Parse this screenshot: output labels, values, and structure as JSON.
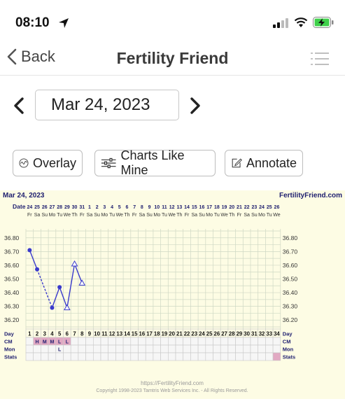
{
  "status_bar": {
    "time": "08:10"
  },
  "nav": {
    "back_label": "Back",
    "title": "Fertility Friend"
  },
  "date_selector": {
    "date": "Mar 24, 2023"
  },
  "buttons": {
    "overlay": "Overlay",
    "charts_like_mine": "Charts Like Mine",
    "annotate": "Annotate"
  },
  "chart": {
    "date_label": "Mar 24, 2023",
    "brand": "FertilityFriend.com",
    "date_row_label": "Date",
    "dates": [
      "24",
      "25",
      "26",
      "27",
      "28",
      "29",
      "30",
      "31",
      "1",
      "2",
      "3",
      "4",
      "5",
      "6",
      "7",
      "8",
      "9",
      "10",
      "11",
      "12",
      "13",
      "14",
      "15",
      "16",
      "17",
      "18",
      "19",
      "20",
      "21",
      "22",
      "23",
      "24",
      "25",
      "26"
    ],
    "weekdays": [
      "Fr",
      "Sa",
      "Su",
      "Mo",
      "Tu",
      "We",
      "Th",
      "Fr",
      "Sa",
      "Su",
      "Mo",
      "Tu",
      "We",
      "Th",
      "Fr",
      "Sa",
      "Su",
      "Mo",
      "Tu",
      "We",
      "Th",
      "Fr",
      "Sa",
      "Su",
      "Mo",
      "Tu",
      "We",
      "Th",
      "Fr",
      "Sa",
      "Su",
      "Mo",
      "Tu",
      "We"
    ],
    "y_ticks": [
      "36.80",
      "36.70",
      "36.60",
      "36.50",
      "36.40",
      "36.30",
      "36.20"
    ],
    "y_min": 36.15,
    "y_max": 36.85,
    "temps": [
      36.71,
      36.57,
      null,
      36.29,
      36.44,
      36.29,
      36.61,
      36.47
    ],
    "open_points": [
      5,
      6,
      7
    ],
    "dashed_segment": [
      1,
      3
    ],
    "row_labels": {
      "day": "Day",
      "cm": "CM",
      "mon": "Mon",
      "stats": "Stats"
    },
    "days": [
      "1",
      "2",
      "3",
      "4",
      "5",
      "6",
      "7",
      "8",
      "9",
      "10",
      "11",
      "12",
      "13",
      "14",
      "15",
      "16",
      "17",
      "18",
      "19",
      "20",
      "21",
      "22",
      "23",
      "24",
      "25",
      "26",
      "27",
      "28",
      "29",
      "30",
      "31",
      "32",
      "33",
      "34"
    ],
    "cm": [
      "",
      "H",
      "M",
      "M",
      "L",
      "L",
      "",
      "",
      "",
      "",
      "",
      "",
      "",
      "",
      "",
      "",
      "",
      "",
      "",
      "",
      "",
      "",
      "",
      "",
      "",
      "",
      "",
      "",
      "",
      "",
      "",
      "",
      "",
      ""
    ],
    "mon": [
      "",
      "",
      "",
      "",
      "L",
      "",
      "",
      "",
      "",
      "",
      "",
      "",
      "",
      "",
      "",
      "",
      "",
      "",
      "",
      "",
      "",
      "",
      "",
      "",
      "",
      "",
      "",
      "",
      "",
      "",
      "",
      "",
      "",
      ""
    ],
    "footer_url": "https://FertilityFriend.com",
    "footer_copyright": "Copyright 1998-2023 Tamtris Web Services Inc. - All Rights Reserved.",
    "colors": {
      "background": "#fdfce4",
      "grid": "#cfd8c4",
      "line": "#3a3acc",
      "highlight": "#e2a9c3",
      "label": "#202070"
    }
  },
  "chart_data": {
    "type": "line",
    "title": "Mar 24, 2023",
    "xlabel": "Day",
    "ylabel": "",
    "ylim": [
      36.2,
      36.8
    ],
    "x": [
      1,
      2,
      4,
      5,
      6,
      7,
      8
    ],
    "series": [
      {
        "values": [
          36.71,
          36.57,
          36.29,
          36.44,
          36.29,
          36.61,
          36.47
        ]
      }
    ]
  }
}
